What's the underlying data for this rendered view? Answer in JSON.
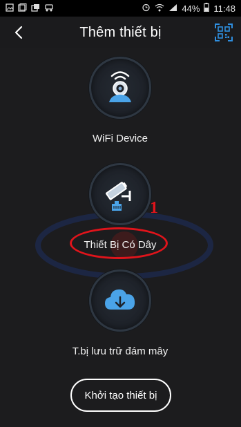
{
  "status_bar": {
    "battery_percent": "44%",
    "time": "11:48",
    "icons": [
      "image-icon",
      "picture-icon",
      "gallery-icon",
      "vehicle-icon",
      "alarm-icon",
      "wifi-icon",
      "signal-icon",
      "battery-icon"
    ]
  },
  "header": {
    "title": "Thêm thiết bị",
    "back_icon": "chevron-left-icon",
    "scan_icon": "qr-scan-icon",
    "accent": "#2f8fe0"
  },
  "options": [
    {
      "label": "WiFi Device",
      "icon": "wifi-camera-icon"
    },
    {
      "label": "Thiết Bị Có Dây",
      "icon": "wired-camera-icon"
    },
    {
      "label": "T.bị lưu trữ đám mây",
      "icon": "cloud-download-icon"
    }
  ],
  "annotation": {
    "number": "1",
    "color": "#e0141b"
  },
  "init_button": {
    "label": "Khởi tạo thiết bị"
  }
}
